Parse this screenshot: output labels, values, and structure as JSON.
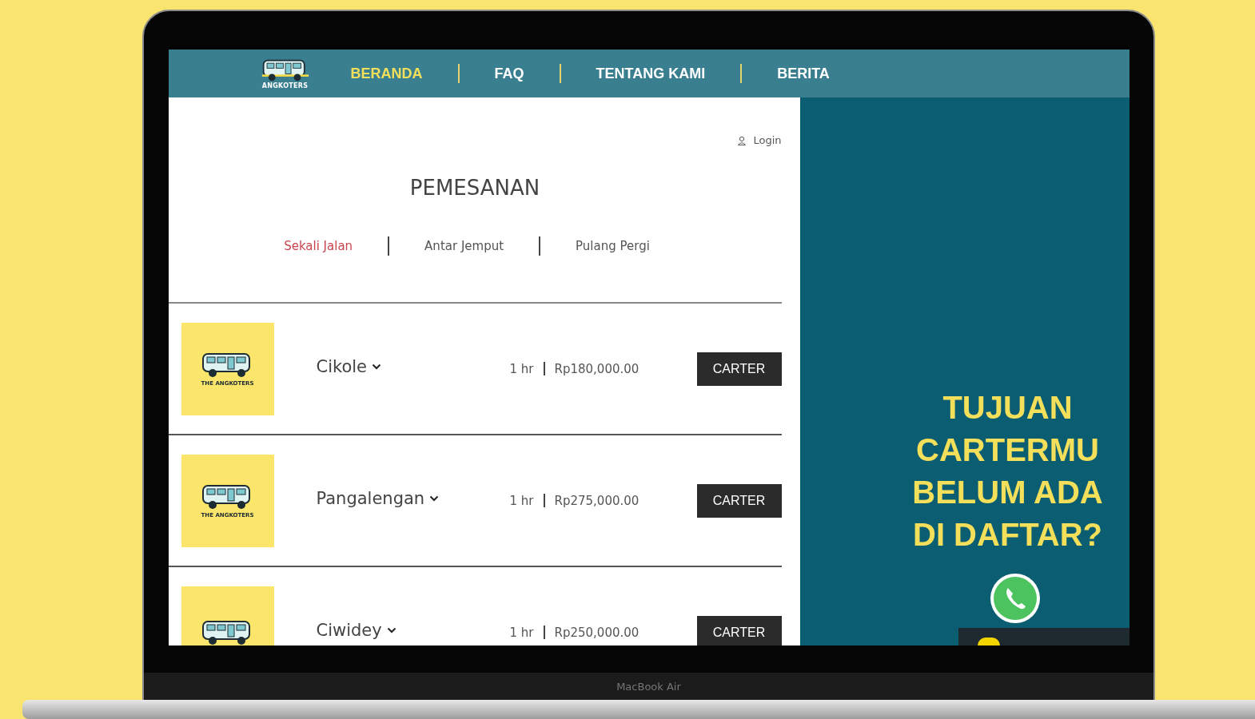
{
  "header": {
    "logo_text": "ANGKOTERS",
    "nav": [
      {
        "label": "BERANDA",
        "selected": true
      },
      {
        "label": "FAQ",
        "selected": false
      },
      {
        "label": "TENTANG KAMI",
        "selected": false
      },
      {
        "label": "BERITA",
        "selected": false
      }
    ]
  },
  "login": "Login",
  "title": "PEMESANAN",
  "trip_tabs": [
    {
      "label": "Sekali Jalan",
      "selected": true
    },
    {
      "label": "Antar Jemput",
      "selected": false
    },
    {
      "label": "Pulang Pergi",
      "selected": false
    }
  ],
  "routes": [
    {
      "logo_text": "THE ANGKOTERS",
      "destination": "Cikole",
      "duration": "1 hr",
      "price": "Rp180,000.00",
      "button": "CARTER"
    },
    {
      "logo_text": "THE ANGKOTERS",
      "destination": "Pangalengan",
      "duration": "1 hr",
      "price": "Rp275,000.00",
      "button": "CARTER"
    },
    {
      "destination": "Ciwidey",
      "duration": "1 hr",
      "price": "Rp250,000.00",
      "button": "CARTER"
    }
  ],
  "promo": {
    "heading_lines": [
      "TUJUAN",
      "CARTERMU",
      "BELUM ADA",
      "DI DAFTAR?"
    ]
  },
  "device_label": "MacBook Air"
}
